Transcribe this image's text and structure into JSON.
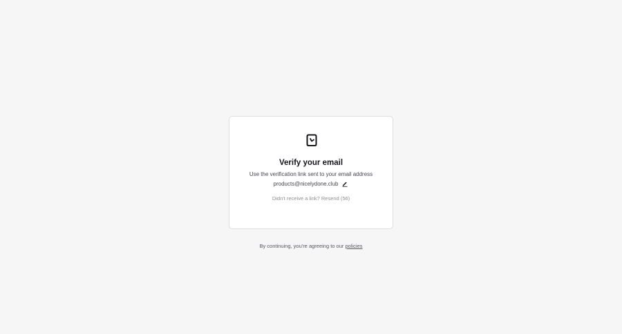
{
  "card": {
    "logo_icon": "bookmark-check-logo-icon",
    "title": "Verify your email",
    "subtitle": "Use the verification link sent to your email address",
    "email": "products@nicelydone.club",
    "edit_icon": "pencil-edit-icon",
    "resend_prompt": "Didn't receive a link?",
    "resend_label": "Resend (56)"
  },
  "footer": {
    "prefix": "By continuing, you're agreeing to our",
    "policies_link": "policies"
  }
}
